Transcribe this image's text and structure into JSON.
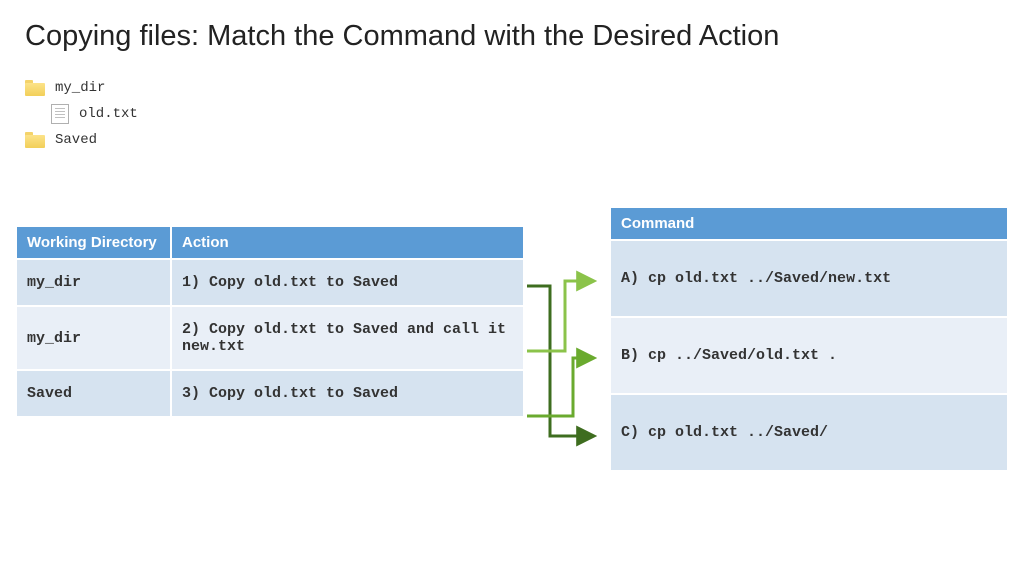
{
  "title": "Copying files: Match the Command with the Desired Action",
  "filetree": {
    "folder1": "my_dir",
    "file1": "old.txt",
    "folder2": "Saved"
  },
  "leftHeaders": {
    "col1": "Working Directory",
    "col2": "Action"
  },
  "rows": [
    {
      "wd": "my_dir",
      "action": "1) Copy old.txt to Saved"
    },
    {
      "wd": "my_dir",
      "action": "2) Copy old.txt to Saved and call it new.txt"
    },
    {
      "wd": "Saved",
      "action": "3) Copy old.txt to Saved"
    }
  ],
  "rightHeader": "Command",
  "commands": [
    {
      "letter": "A)",
      "cmd": "cp old.txt ../Saved/new.txt"
    },
    {
      "letter": "B)",
      "cmd": "cp ../Saved/old.txt ."
    },
    {
      "letter": "C)",
      "cmd": "cp old.txt ../Saved/"
    }
  ],
  "arrowColors": {
    "light": "#8bc34a",
    "mid": "#6aaa2e",
    "dark": "#3e6d1f"
  }
}
